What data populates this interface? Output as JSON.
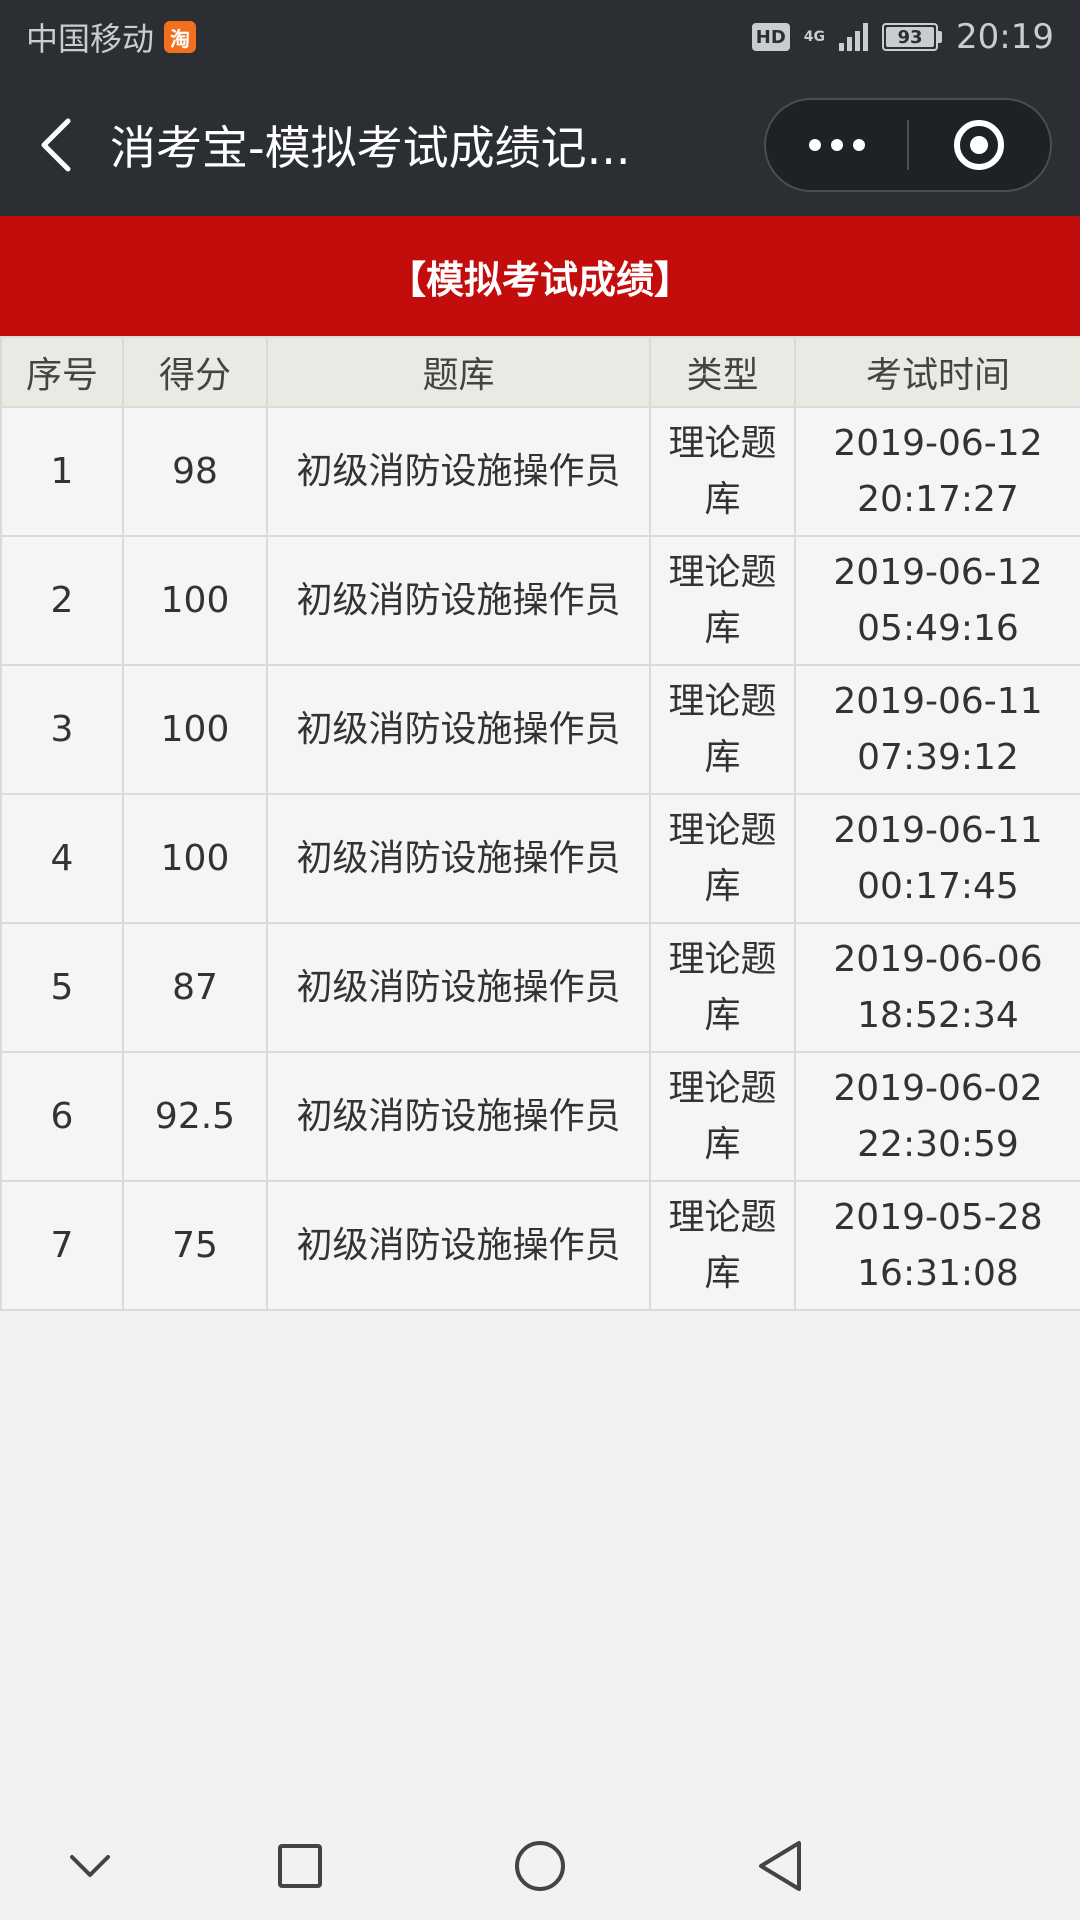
{
  "status_bar": {
    "carrier": "中国移动",
    "carrier_badge": "淘",
    "hd_label": "HD",
    "network_label": "4G",
    "battery": "93",
    "time": "20:19"
  },
  "nav": {
    "title": "消考宝-模拟考试成绩记..."
  },
  "section": {
    "title": "【模拟考试成绩】"
  },
  "table": {
    "headers": [
      "序号",
      "得分",
      "题库",
      "类型",
      "考试时间"
    ],
    "rows": [
      {
        "no": "1",
        "score": "98",
        "bank": "初级消防设施操作员",
        "type": "理论题库",
        "date": "2019-06-12",
        "time": "20:17:27"
      },
      {
        "no": "2",
        "score": "100",
        "bank": "初级消防设施操作员",
        "type": "理论题库",
        "date": "2019-06-12",
        "time": "05:49:16"
      },
      {
        "no": "3",
        "score": "100",
        "bank": "初级消防设施操作员",
        "type": "理论题库",
        "date": "2019-06-11",
        "time": "07:39:12"
      },
      {
        "no": "4",
        "score": "100",
        "bank": "初级消防设施操作员",
        "type": "理论题库",
        "date": "2019-06-11",
        "time": "00:17:45"
      },
      {
        "no": "5",
        "score": "87",
        "bank": "初级消防设施操作员",
        "type": "理论题库",
        "date": "2019-06-06",
        "time": "18:52:34"
      },
      {
        "no": "6",
        "score": "92.5",
        "bank": "初级消防设施操作员",
        "type": "理论题库",
        "date": "2019-06-02",
        "time": "22:30:59"
      },
      {
        "no": "7",
        "score": "75",
        "bank": "初级消防设施操作员",
        "type": "理论题库",
        "date": "2019-05-28",
        "time": "16:31:08"
      }
    ]
  },
  "colors": {
    "nav_background": "#2b2f33",
    "header_red": "#c30d0d",
    "table_header_bg": "#e8ebe4",
    "page_bg": "#f2f2f2"
  }
}
